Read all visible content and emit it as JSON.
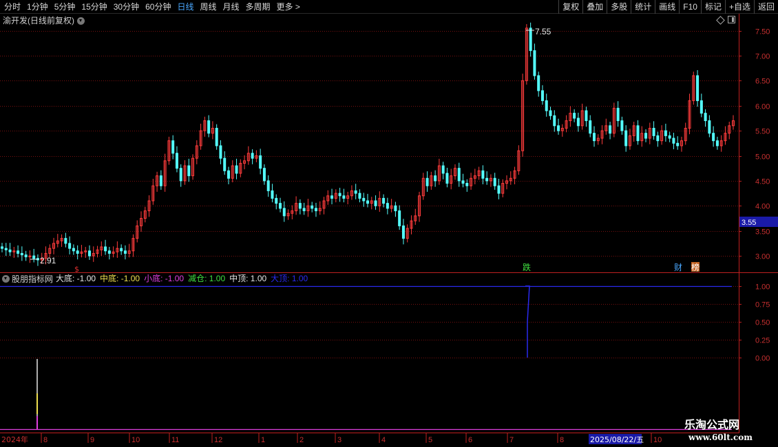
{
  "toolbar": {
    "periods": [
      "分时",
      "1分钟",
      "5分钟",
      "15分钟",
      "30分钟",
      "60分钟",
      "日线",
      "周线",
      "月线",
      "多周期",
      "更多 >"
    ],
    "active_period": "日线",
    "actions": [
      "复权",
      "叠加",
      "多股",
      "统计",
      "画线",
      "F10",
      "标记",
      "+自选",
      "返回"
    ]
  },
  "stock": {
    "title": "渝开发(日线前复权)"
  },
  "price_axis": {
    "ticks": [
      "7.50",
      "7.00",
      "6.50",
      "6.00",
      "5.50",
      "5.00",
      "4.50",
      "4.00",
      "3.50",
      "3.00"
    ]
  },
  "annotations": {
    "high_label": "7.55",
    "low_label": "2.91",
    "current_price_tag": "3.55",
    "fall_marker": "跌",
    "finance_marker": "财",
    "news_marker": "榜",
    "small_marker": "$"
  },
  "indicator": {
    "name": "股朋指标网",
    "items": [
      {
        "text": "大底: -1.00",
        "color": "#e8e8e8"
      },
      {
        "text": "中底: -1.00",
        "color": "#f0e050"
      },
      {
        "text": "小底: -1.00",
        "color": "#e040e0"
      },
      {
        "text": "减仓: 1.00",
        "color": "#40e040"
      },
      {
        "text": "中顶: 1.00",
        "color": "#e8e8e8"
      },
      {
        "text": "大顶: 1.00",
        "color": "#2a2af0"
      }
    ],
    "ticks": [
      "1.00",
      "0.75",
      "0.50",
      "0.25",
      "0.00"
    ]
  },
  "date_axis": {
    "year_label": "2024年",
    "months": [
      "8",
      "9",
      "10",
      "11",
      "12",
      "1",
      "2",
      "3",
      "4",
      "5",
      "6",
      "7",
      "8",
      "10"
    ],
    "cursor_date": "2025/08/22/五"
  },
  "watermark": {
    "line1": "乐淘公式网",
    "line2": "www.60lt.com"
  },
  "colors": {
    "up": "#ff3c3c",
    "down": "#54ffff",
    "grid": "#7a1010",
    "axis": "#c02020",
    "signal": "#2a2af0"
  },
  "chart_data": {
    "type": "candlestick",
    "title": "渝开发(日线前复权)",
    "high": 7.55,
    "low": 2.91,
    "ylim": [
      2.7,
      7.75
    ],
    "closes": [
      3.15,
      3.12,
      3.08,
      3.1,
      3.05,
      3.02,
      2.98,
      3.0,
      2.95,
      2.92,
      2.95,
      3.05,
      3.15,
      3.25,
      3.3,
      3.35,
      3.25,
      3.15,
      3.1,
      3.05,
      3.08,
      3.1,
      3.0,
      3.05,
      3.12,
      3.18,
      3.1,
      3.05,
      3.08,
      3.15,
      3.1,
      3.05,
      3.1,
      3.35,
      3.6,
      3.75,
      3.9,
      4.1,
      4.4,
      4.6,
      4.4,
      4.9,
      5.3,
      5.05,
      4.75,
      4.5,
      4.8,
      4.6,
      4.95,
      5.2,
      5.5,
      5.7,
      5.45,
      5.55,
      5.2,
      4.95,
      4.7,
      4.55,
      4.8,
      4.65,
      4.85,
      4.9,
      5.05,
      4.95,
      5.0,
      4.75,
      4.5,
      4.3,
      4.15,
      4.05,
      3.95,
      3.8,
      3.85,
      3.9,
      4.05,
      3.95,
      3.9,
      4.0,
      3.95,
      3.9,
      3.95,
      4.1,
      4.2,
      4.15,
      4.25,
      4.2,
      4.15,
      4.2,
      4.3,
      4.25,
      4.15,
      4.1,
      4.05,
      4.1,
      4.0,
      4.15,
      4.05,
      3.95,
      4.0,
      3.9,
      3.6,
      3.35,
      3.55,
      3.7,
      3.8,
      4.2,
      4.55,
      4.4,
      4.6,
      4.5,
      4.8,
      4.65,
      4.45,
      4.6,
      4.75,
      4.5,
      4.45,
      4.4,
      4.55,
      4.6,
      4.7,
      4.55,
      4.5,
      4.55,
      4.4,
      4.25,
      4.45,
      4.5,
      4.55,
      4.7,
      5.1,
      6.5,
      7.55,
      7.1,
      6.6,
      6.3,
      6.1,
      5.9,
      5.8,
      5.6,
      5.5,
      5.55,
      5.7,
      5.85,
      5.75,
      5.6,
      5.9,
      5.7,
      5.45,
      5.3,
      5.35,
      5.5,
      5.6,
      5.45,
      5.95,
      5.7,
      5.5,
      5.2,
      5.4,
      5.6,
      5.3,
      5.45,
      5.35,
      5.55,
      5.4,
      5.3,
      5.5,
      5.4,
      5.35,
      5.25,
      5.2,
      5.3,
      5.55,
      6.1,
      6.6,
      6.1,
      5.85,
      5.7,
      5.45,
      5.3,
      5.2,
      5.3,
      5.45,
      5.6,
      5.7
    ]
  }
}
